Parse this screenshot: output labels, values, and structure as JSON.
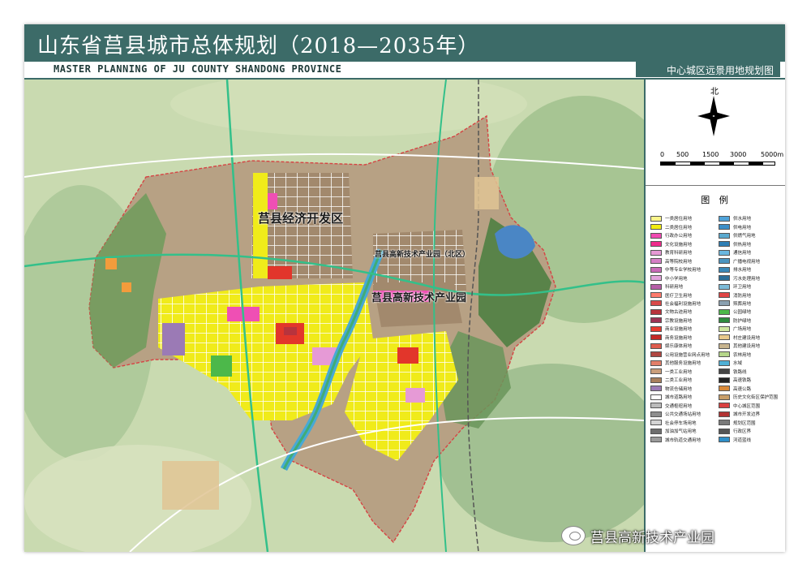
{
  "header": {
    "title": "山东省莒县城市总体规划（2018—2035年）",
    "subtitle": "MASTER PLANNING OF JU COUNTY SHANDONG PROVINCE",
    "map_name": "中心城区远景用地规划图"
  },
  "compass": {
    "north_label": "北",
    "icon": "north-arrow-icon"
  },
  "scale_bar": {
    "labels": [
      "0",
      "500",
      "1500",
      "3000",
      "5000m"
    ]
  },
  "map_labels": {
    "economic_zone": "莒县经济开发区",
    "high_tech_zone": "莒县高新技术产业园",
    "high_tech_zone_north": "莒县高新技术产业园（北区）"
  },
  "legend": {
    "title": "图 例",
    "left": [
      {
        "label": "一类居住用地",
        "color": "#fbf58a"
      },
      {
        "label": "二类居住用地",
        "color": "#f2ec12"
      },
      {
        "label": "行政办公用地",
        "color": "#f049b2"
      },
      {
        "label": "文化设施用地",
        "color": "#ef2b8c"
      },
      {
        "label": "教育科研用地",
        "color": "#e69ad6"
      },
      {
        "label": "高等院校用地",
        "color": "#d57fc6"
      },
      {
        "label": "中等专业学校用地",
        "color": "#c96ab8"
      },
      {
        "label": "中小学用地",
        "color": "#e2a4dd"
      },
      {
        "label": "科研用地",
        "color": "#b65ea8"
      },
      {
        "label": "医疗卫生用地",
        "color": "#ff7b6c"
      },
      {
        "label": "社会福利设施用地",
        "color": "#d94a4a"
      },
      {
        "label": "文物古迹用地",
        "color": "#b8333d"
      },
      {
        "label": "宗教设施用地",
        "color": "#9e3355"
      },
      {
        "label": "商业设施用地",
        "color": "#e83b2f"
      },
      {
        "label": "商务设施用地",
        "color": "#c42824"
      },
      {
        "label": "娱乐康体用地",
        "color": "#de5c4e"
      },
      {
        "label": "公用设施营业网点用地",
        "color": "#b04642"
      },
      {
        "label": "其他服务设施用地",
        "color": "#e27f6a"
      },
      {
        "label": "一类工业用地",
        "color": "#c99e7b"
      },
      {
        "label": "二类工业用地",
        "color": "#a87f5c"
      },
      {
        "label": "物流仓储用地",
        "color": "#9b7ab5"
      },
      {
        "label": "城市道路用地",
        "color": "#ffffff"
      },
      {
        "label": "交通枢纽用地",
        "color": "#bcbcbc"
      },
      {
        "label": "公共交通场站用地",
        "color": "#8f8f8f"
      },
      {
        "label": "社会停车场用地",
        "color": "#d4d4d4"
      },
      {
        "label": "加油加气站用地",
        "color": "#6e6e6e"
      },
      {
        "label": "城市轨道交通用地",
        "color": "#9a9a9a"
      }
    ],
    "right": [
      {
        "label": "供水用地",
        "color": "#4fa3d9"
      },
      {
        "label": "供电用地",
        "color": "#3c8ec7"
      },
      {
        "label": "供燃气用地",
        "color": "#5aa9cf"
      },
      {
        "label": "供热用地",
        "color": "#2f7fb5"
      },
      {
        "label": "通信用地",
        "color": "#6bb7df"
      },
      {
        "label": "广播电视用地",
        "color": "#4c95c0"
      },
      {
        "label": "排水用地",
        "color": "#3a88b8"
      },
      {
        "label": "污水处理用地",
        "color": "#2d6f99"
      },
      {
        "label": "环卫用地",
        "color": "#7dbbd8"
      },
      {
        "label": "消防用地",
        "color": "#e04545"
      },
      {
        "label": "殡葬用地",
        "color": "#8aa0b0"
      },
      {
        "label": "公园绿地",
        "color": "#4cb84a"
      },
      {
        "label": "防护绿地",
        "color": "#2e8b3e"
      },
      {
        "label": "广场用地",
        "color": "#cfe7a0"
      },
      {
        "label": "村庄建设用地",
        "color": "#e7c98c"
      },
      {
        "label": "其他建设用地",
        "color": "#c7b48e"
      },
      {
        "label": "农林用地",
        "color": "#b5d68a"
      },
      {
        "label": "水域",
        "color": "#4fb0d6"
      },
      {
        "label": "铁路线",
        "color": "#444444"
      },
      {
        "label": "高速铁路",
        "color": "#222222"
      },
      {
        "label": "高速公路",
        "color": "#d98a3a"
      },
      {
        "label": "历史文化街区保护范围",
        "color": "#c79e6a"
      },
      {
        "label": "中心城区范围",
        "color": "#d94040"
      },
      {
        "label": "城市开发边界",
        "color": "#b23333"
      },
      {
        "label": "规划区范围",
        "color": "#7a7a7a"
      },
      {
        "label": "行政区界",
        "color": "#555555"
      },
      {
        "label": "河道蓝线",
        "color": "#2f8fc8"
      }
    ]
  },
  "watermark": {
    "text": "莒县高新技术产业园",
    "icon": "wechat-icon"
  }
}
